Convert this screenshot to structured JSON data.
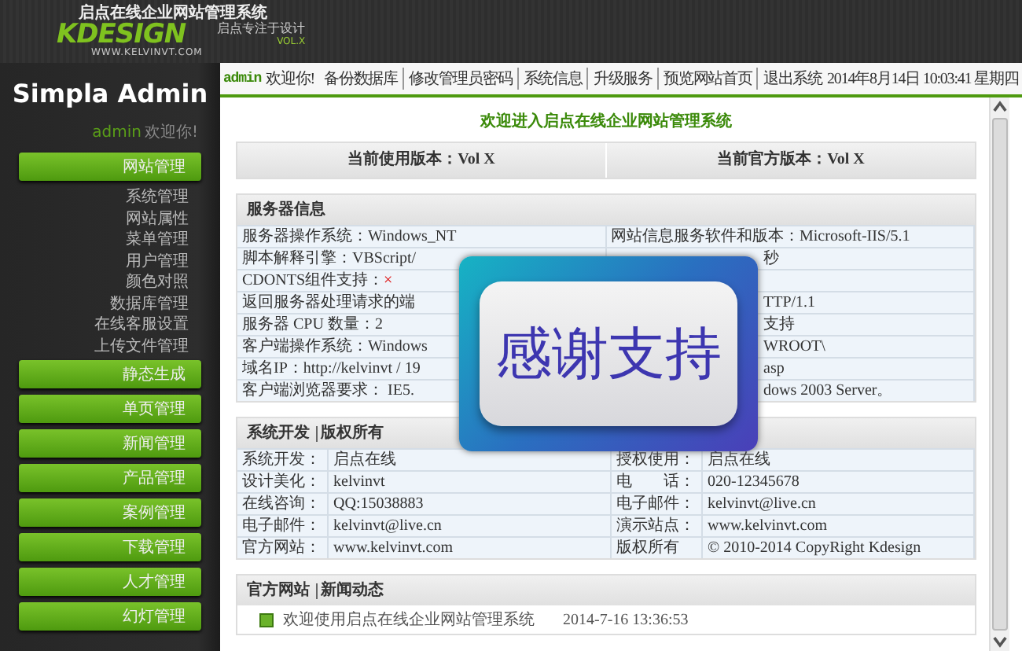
{
  "header": {
    "title": "启点在线企业网站管理系统",
    "logo": "KDESIGN",
    "url": "WWW.KELVINVT.COM",
    "slogan": "启点专注于设计",
    "version": "VOL.X"
  },
  "sidebar": {
    "title": "Simpla Admin",
    "user": "admin",
    "greeting": "欢迎你!",
    "menus": [
      {
        "label": "网站管理",
        "children": [
          {
            "label": "系统管理"
          },
          {
            "label": "网站属性"
          },
          {
            "label": "菜单管理"
          },
          {
            "label": "用户管理"
          },
          {
            "label": "颜色对照"
          },
          {
            "label": "数据库管理"
          },
          {
            "label": "在线客服设置"
          },
          {
            "label": "上传文件管理"
          }
        ]
      },
      {
        "label": "静态生成"
      },
      {
        "label": "单页管理"
      },
      {
        "label": "新闻管理"
      },
      {
        "label": "产品管理"
      },
      {
        "label": "案例管理"
      },
      {
        "label": "下载管理"
      },
      {
        "label": "人才管理"
      },
      {
        "label": "幻灯管理"
      }
    ]
  },
  "topbar": {
    "user": "admin",
    "greeting": "欢迎你!",
    "links": [
      "备份数据库",
      "修改管理员密码",
      "系统信息",
      "升级服务",
      "预览网站首页",
      "退出系统"
    ],
    "datetime": "2014年8月14日 10:03:41 星期四"
  },
  "content": {
    "welcome": "欢迎进入启点在线企业网站管理系统",
    "versions": [
      "当前使用版本：Vol X",
      "当前官方版本：Vol X"
    ],
    "server_info": {
      "title": "服务器信息",
      "rows": [
        {
          "left": "服务器操作系统：Windows_NT",
          "right": "网站信息服务软件和版本：Microsoft-IIS/5.1",
          "covered": false
        },
        {
          "left": "脚本解释引擎：VBScript/",
          "right": "秒",
          "covered": true
        },
        {
          "left": "CDONTS组件支持：",
          "cross": "×"
        },
        {
          "left": "返回服务器处理请求的端",
          "right": "TTP/1.1",
          "covered": true
        },
        {
          "left": "服务器 CPU 数量：2",
          "right": "支持",
          "covered": true
        },
        {
          "left": "客户端操作系统：Windows",
          "right": "WROOT\\",
          "covered": true
        },
        {
          "left": "域名IP：http://kelvinvt / 19",
          "right": "asp",
          "covered": true
        },
        {
          "left": "客户端浏览器要求： IE5.",
          "right": "dows 2003 Server。",
          "covered": true
        }
      ]
    },
    "about": {
      "tabs": [
        "系统开发",
        "版权所有"
      ],
      "rows": [
        [
          "系统开发：",
          "启点在线",
          "授权使用：",
          "启点在线"
        ],
        [
          "设计美化：",
          "kelvinvt",
          "电　　话：",
          "020-12345678"
        ],
        [
          "在线咨询：",
          "QQ:15038883",
          "电子邮件：",
          "kelvinvt@live.cn"
        ],
        [
          "电子邮件：",
          "kelvinvt@live.cn",
          "演示站点：",
          "www.kelvinvt.com"
        ],
        [
          "官方网站：",
          "www.kelvinvt.com",
          "版权所有",
          "© 2010-2014 CopyRight Kdesign"
        ]
      ]
    },
    "news": {
      "tabs": [
        "官方网站",
        "新闻动态"
      ],
      "items": [
        {
          "title": "欢迎使用启点在线企业网站管理系统",
          "date": "2014-7-16 13:36:53"
        }
      ]
    }
  },
  "overlay": {
    "text": "感谢支持"
  }
}
